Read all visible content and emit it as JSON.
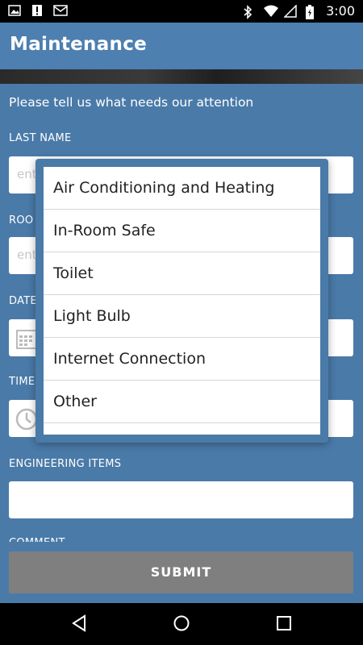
{
  "status_bar": {
    "time": "3:00",
    "left_icons": [
      "image-icon",
      "alert-icon",
      "email-icon"
    ],
    "right_icons": [
      "bluetooth-icon",
      "wifi-icon",
      "signal-icon",
      "battery-icon"
    ]
  },
  "app_bar": {
    "title": "Maintenance"
  },
  "form": {
    "intro": "Please tell us what needs our attention",
    "last_name": {
      "label": "LAST NAME",
      "placeholder": "ent"
    },
    "room": {
      "label": "ROO",
      "placeholder": "ent"
    },
    "date": {
      "label": "DATE"
    },
    "time": {
      "label": "TIME"
    },
    "engineering_items": {
      "label": "ENGINEERING ITEMS",
      "value": ""
    },
    "comment": {
      "label": "COMMENT"
    },
    "submit_label": "SUBMIT"
  },
  "dialog": {
    "options": [
      "Air Conditioning and Heating",
      "In-Room Safe",
      "Toilet",
      "Light Bulb",
      "Internet Connection",
      "Other",
      ""
    ]
  },
  "colors": {
    "app_bar": "#4d7fb0",
    "background": "#4a7aa8",
    "submit": "#7f7f7f"
  }
}
